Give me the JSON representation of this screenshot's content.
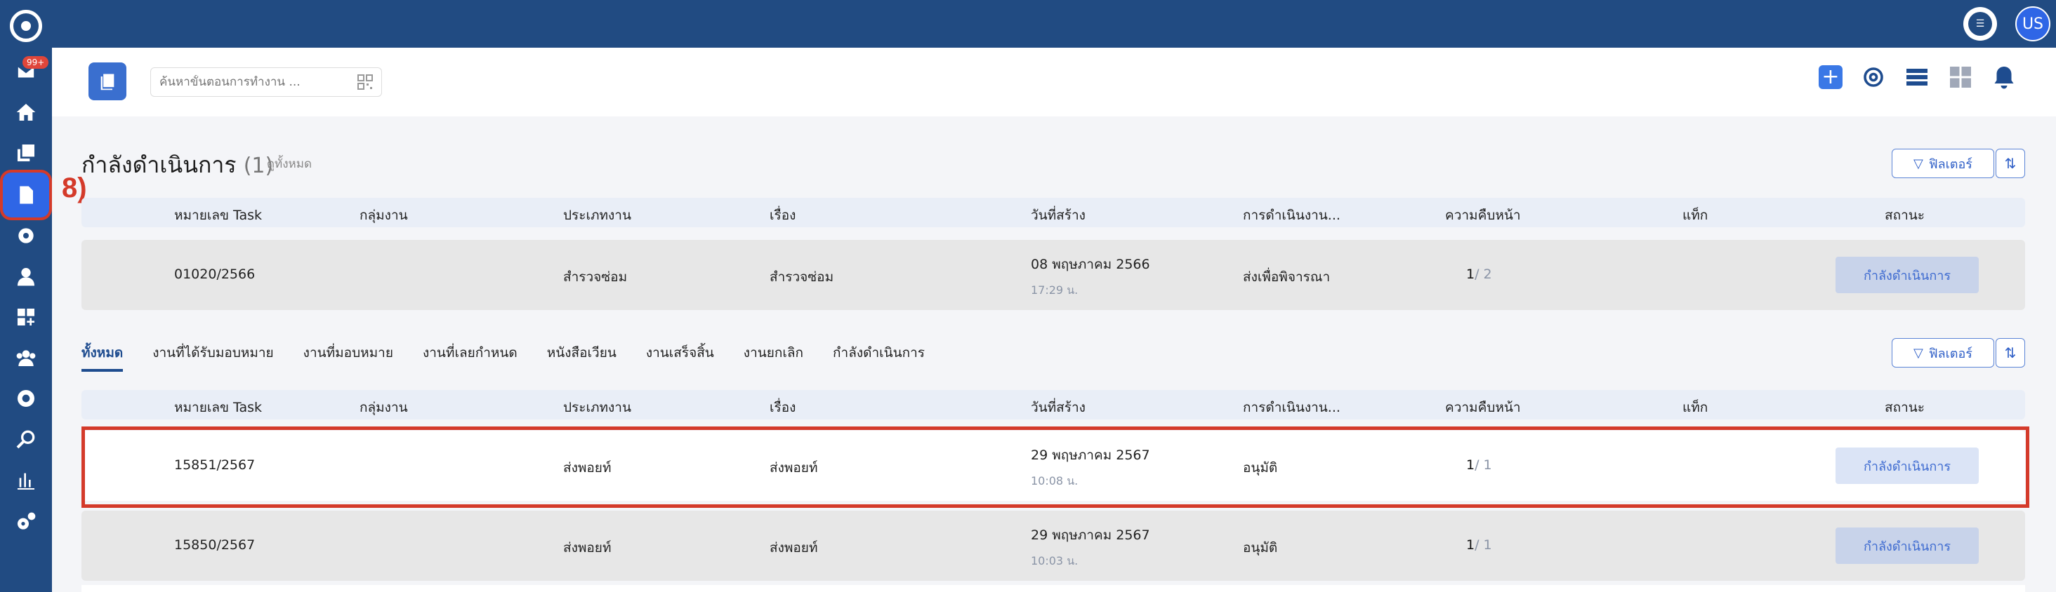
{
  "sidebar": {
    "badge": "99+",
    "annotation": "8)"
  },
  "topbar": {
    "user_initials": "US"
  },
  "header": {
    "search_placeholder": "ค้นหาขั้นตอนการทำงาน ..."
  },
  "in_progress": {
    "title": "กำลังดำเนินการ",
    "count": "(1)",
    "see_all": "ดูทั้งหมด",
    "filter_label": "ฟิลเตอร์",
    "columns": [
      "หมายเลข Task",
      "กลุ่มงาน",
      "ประเภทงาน",
      "เรื่อง",
      "วันที่สร้าง",
      "การดำเนินงาน...",
      "ความคืบหน้า",
      "แท็ก",
      "สถานะ"
    ],
    "rows": [
      {
        "task": "01020/2566",
        "group": "",
        "type": "สำรวจซ่อม",
        "subject": "สำรวจซ่อม",
        "date": "08 พฤษภาคม 2566",
        "time": "17:29 น.",
        "action": "ส่งเพื่อพิจารณา",
        "progress_done": "1",
        "progress_total": "/ 2",
        "tag": "",
        "status": "กำลังดำเนินการ"
      }
    ]
  },
  "all_tasks": {
    "tabs": [
      "ทั้งหมด",
      "งานที่ได้รับมอบหมาย",
      "งานที่มอบหมาย",
      "งานที่เลยกำหนด",
      "หนังสือเวียน",
      "งานเสร็จสิ้น",
      "งานยกเลิก",
      "กำลังดำเนินการ"
    ],
    "filter_label": "ฟิลเตอร์",
    "columns": [
      "หมายเลข Task",
      "กลุ่มงาน",
      "ประเภทงาน",
      "เรื่อง",
      "วันที่สร้าง",
      "การดำเนินงาน...",
      "ความคืบหน้า",
      "แท็ก",
      "สถานะ"
    ],
    "rows": [
      {
        "task": "15851/2567",
        "group": "",
        "type": "ส่งพอยท์",
        "subject": "ส่งพอยท์",
        "date": "29 พฤษภาคม 2567",
        "time": "10:08 น.",
        "action": "อนุมัติ",
        "progress_done": "1",
        "progress_total": "/ 1",
        "tag": "",
        "status": "กำลังดำเนินการ"
      },
      {
        "task": "15850/2567",
        "group": "",
        "type": "ส่งพอยท์",
        "subject": "ส่งพอยท์",
        "date": "29 พฤษภาคม 2567",
        "time": "10:03 น.",
        "action": "อนุมัติ",
        "progress_done": "1",
        "progress_total": "/ 1",
        "tag": "",
        "status": "กำลังดำเนินการ"
      }
    ]
  }
}
